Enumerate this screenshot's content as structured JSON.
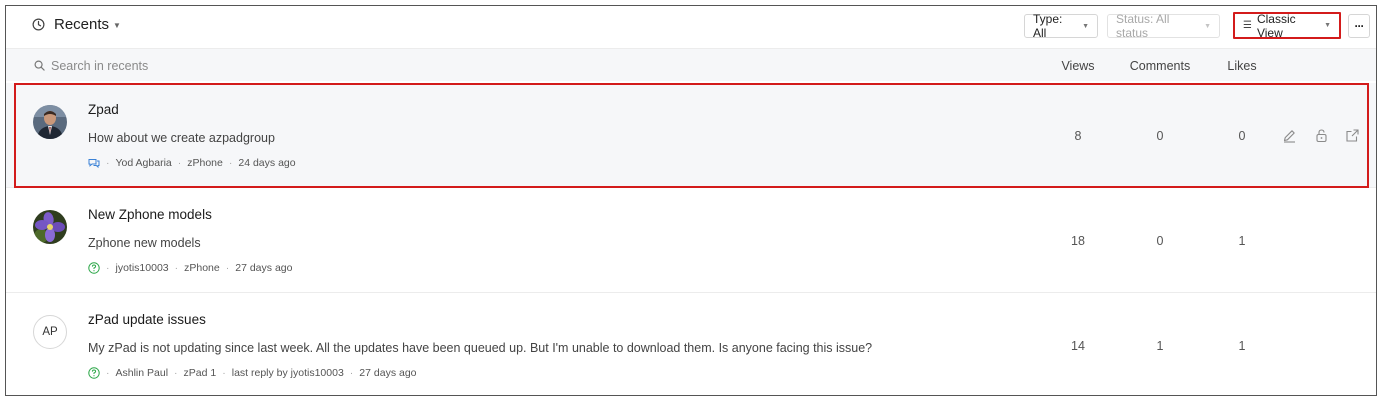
{
  "header": {
    "title": "Recents",
    "type_filter": "Type: All",
    "status_filter": "Status: All status",
    "view_button": "Classic View",
    "more": "···"
  },
  "search": {
    "placeholder": "Search in recents"
  },
  "columns": {
    "views": "Views",
    "comments": "Comments",
    "likes": "Likes"
  },
  "posts": [
    {
      "title": "Zpad",
      "snippet": "How about we create azpadgroup",
      "type_icon": "discussion-icon",
      "author": "Yod Agbaria",
      "forum": "zPhone",
      "last_reply": "",
      "time": "24 days ago",
      "views": "8",
      "comments": "0",
      "likes": "0",
      "avatar": "photo"
    },
    {
      "title": "New Zphone models",
      "snippet": "Zphone new models",
      "type_icon": "question-icon",
      "author": "jyotis10003",
      "forum": "zPhone",
      "last_reply": "",
      "time": "27 days ago",
      "views": "18",
      "comments": "0",
      "likes": "1",
      "avatar": "flower"
    },
    {
      "title": "zPad update issues",
      "snippet": "My zPad is not updating since last week. All the updates have been queued up. But I'm unable to download them. Is anyone facing this issue?",
      "type_icon": "question-icon",
      "author": "Ashlin Paul",
      "forum": "zPad 1",
      "last_reply": "last reply by jyotis10003",
      "time": "27 days ago",
      "views": "14",
      "comments": "1",
      "likes": "1",
      "avatar": "AP"
    }
  ],
  "colors": {
    "highlight": "#d31b1b",
    "question": "#2ea84a",
    "discussion": "#3b82d6"
  }
}
